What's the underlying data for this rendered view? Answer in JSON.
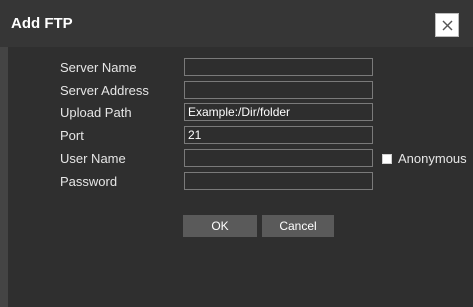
{
  "dialog": {
    "title": "Add FTP",
    "close_icon": "close-icon"
  },
  "form": {
    "server_name": {
      "label": "Server Name",
      "value": ""
    },
    "server_address": {
      "label": "Server Address",
      "value": ""
    },
    "upload_path": {
      "label": "Upload Path",
      "placeholder": "Example:/Dir/folder",
      "value": ""
    },
    "port": {
      "label": "Port",
      "value": "21"
    },
    "user_name": {
      "label": "User Name",
      "value": ""
    },
    "anonymous": {
      "label": "Anonymous",
      "checked": false
    },
    "password": {
      "label": "Password",
      "value": ""
    }
  },
  "buttons": {
    "ok_label": "OK",
    "cancel_label": "Cancel"
  },
  "colors": {
    "background": "#2f2f2f",
    "titlebar": "#363636",
    "button": "#5a5a5a",
    "text": "#e6e6e6",
    "field_border": "#7a7a7a"
  }
}
